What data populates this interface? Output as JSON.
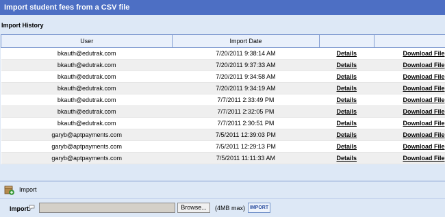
{
  "header": {
    "title": "Import student fees from a CSV file"
  },
  "history": {
    "label": "Import History",
    "columns": [
      "User",
      "Import Date",
      "",
      ""
    ],
    "rows": [
      {
        "user": "bkauth@edutrak.com",
        "date": "7/20/2011 9:38:14 AM",
        "details": "Details",
        "download": "Download File"
      },
      {
        "user": "bkauth@edutrak.com",
        "date": "7/20/2011 9:37:33 AM",
        "details": "Details",
        "download": "Download File"
      },
      {
        "user": "bkauth@edutrak.com",
        "date": "7/20/2011 9:34:58 AM",
        "details": "Details",
        "download": "Download File"
      },
      {
        "user": "bkauth@edutrak.com",
        "date": "7/20/2011 9:34:19 AM",
        "details": "Details",
        "download": "Download File"
      },
      {
        "user": "bkauth@edutrak.com",
        "date": "7/7/2011 2:33:49 PM",
        "details": "Details",
        "download": "Download File"
      },
      {
        "user": "bkauth@edutrak.com",
        "date": "7/7/2011 2:32:05 PM",
        "details": "Details",
        "download": "Download File"
      },
      {
        "user": "bkauth@edutrak.com",
        "date": "7/7/2011 2:30:51 PM",
        "details": "Details",
        "download": "Download File"
      },
      {
        "user": "garyb@aptpayments.com",
        "date": "7/5/2011 12:39:03 PM",
        "details": "Details",
        "download": "Download File"
      },
      {
        "user": "garyb@aptpayments.com",
        "date": "7/5/2011 12:29:13 PM",
        "details": "Details",
        "download": "Download File"
      },
      {
        "user": "garyb@aptpayments.com",
        "date": "7/5/2011 11:11:33 AM",
        "details": "Details",
        "download": "Download File"
      }
    ]
  },
  "import": {
    "title": "Import",
    "field_label": "Import:",
    "file_value": "",
    "browse_label": "Browse...",
    "max_label": "(4MB max)",
    "import_button": "IMPORT"
  },
  "colors": {
    "titlebar": "#4d6fc4",
    "background": "#dde8f6",
    "row_alt": "#efefef"
  },
  "icons": {
    "import": "import-box-icon",
    "help": "speech-bubble-help-icon"
  }
}
